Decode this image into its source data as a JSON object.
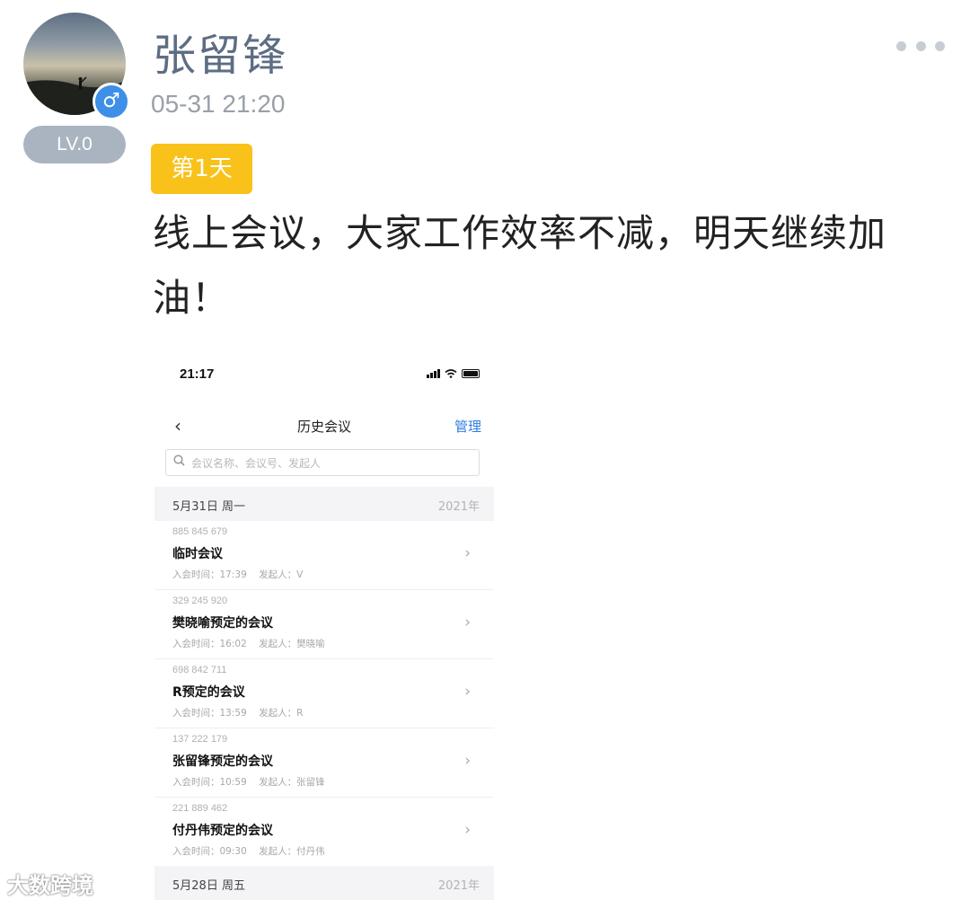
{
  "post": {
    "username": "张留锋",
    "timestamp": "05-31 21:20",
    "level": "LV.0",
    "gender_symbol": "♂",
    "day_badge": "第1天",
    "text": "线上会议，大家工作效率不减，明天继续加油！"
  },
  "screenshot": {
    "status_time": "21:17",
    "nav_back": "‹",
    "nav_title": "历史会议",
    "nav_manage": "管理",
    "search_placeholder": "会议名称、会议号、发起人",
    "groups": [
      {
        "date": "5月31日 周一",
        "year": "2021年"
      },
      {
        "date": "5月28日 周五",
        "year": "2021年"
      }
    ],
    "meetings": [
      {
        "id": "885 845 679",
        "name": "临时会议",
        "time": "入会时间：17:39",
        "host": "发起人：V"
      },
      {
        "id": "329 245 920",
        "name": "樊晓喻预定的会议",
        "time": "入会时间：16:02",
        "host": "发起人：樊晓喻"
      },
      {
        "id": "698 842 711",
        "name": "R预定的会议",
        "time": "入会时间：13:59",
        "host": "发起人：R"
      },
      {
        "id": "137 222 179",
        "name": "张留锋预定的会议",
        "time": "入会时间：10:59",
        "host": "发起人：张留锋"
      },
      {
        "id": "221 889 462",
        "name": "付丹伟预定的会议",
        "time": "入会时间：09:30",
        "host": "发起人：付丹伟"
      }
    ]
  },
  "watermark": "大数跨境",
  "colors": {
    "username": "#5d6d84",
    "badge": "#f9c21a",
    "level_pill": "#aab4c1",
    "gender": "#3d8fe8",
    "link_blue": "#2f7de0"
  }
}
